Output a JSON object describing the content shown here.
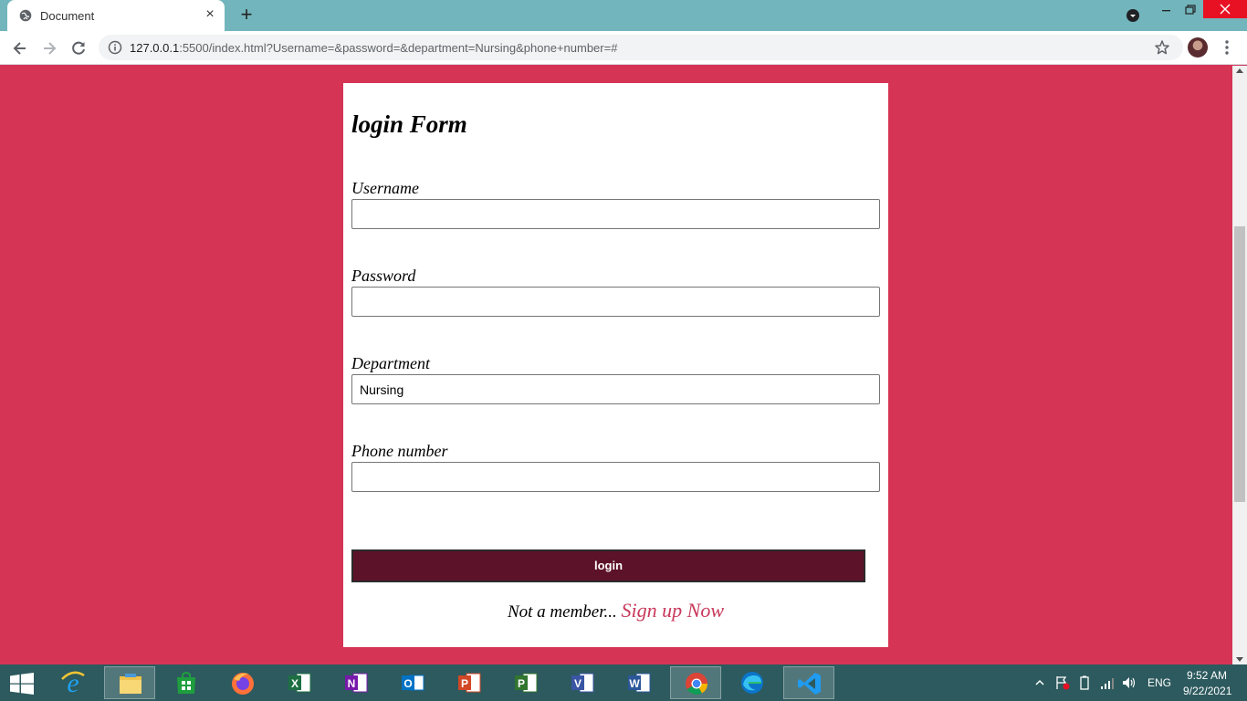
{
  "browser": {
    "tab_title": "Document",
    "new_tab": "+",
    "tab_close": "×",
    "url_host": "127.0.0.1",
    "url_rest": ":5500/index.html?Username=&password=&department=Nursing&phone+number=#"
  },
  "form": {
    "title": "login Form",
    "fields": [
      {
        "label": "Username",
        "value": ""
      },
      {
        "label": "Password",
        "value": ""
      },
      {
        "label": "Department",
        "value": "Nursing"
      },
      {
        "label": "Phone number",
        "value": ""
      }
    ],
    "submit_label": "login",
    "footer_text": "Not a member...",
    "signup_link": "Sign up Now"
  },
  "taskbar": {
    "apps": [
      "start-icon",
      "internet-explorer-icon",
      "file-explorer-icon",
      "store-icon",
      "firefox-icon",
      "excel-icon",
      "onenote-icon",
      "outlook-icon",
      "powerpoint-icon",
      "project-icon",
      "visio-icon",
      "word-icon",
      "chrome-icon",
      "edge-icon",
      "vscode-icon"
    ],
    "language": "ENG",
    "time": "9:52 AM",
    "date": "9/22/2021"
  },
  "colors": {
    "page_background": "#d63455",
    "button_background": "#5c1228",
    "signup_link": "#c8385a",
    "tab_strip": "#72b5bc",
    "taskbar": "#2d5a5e"
  }
}
